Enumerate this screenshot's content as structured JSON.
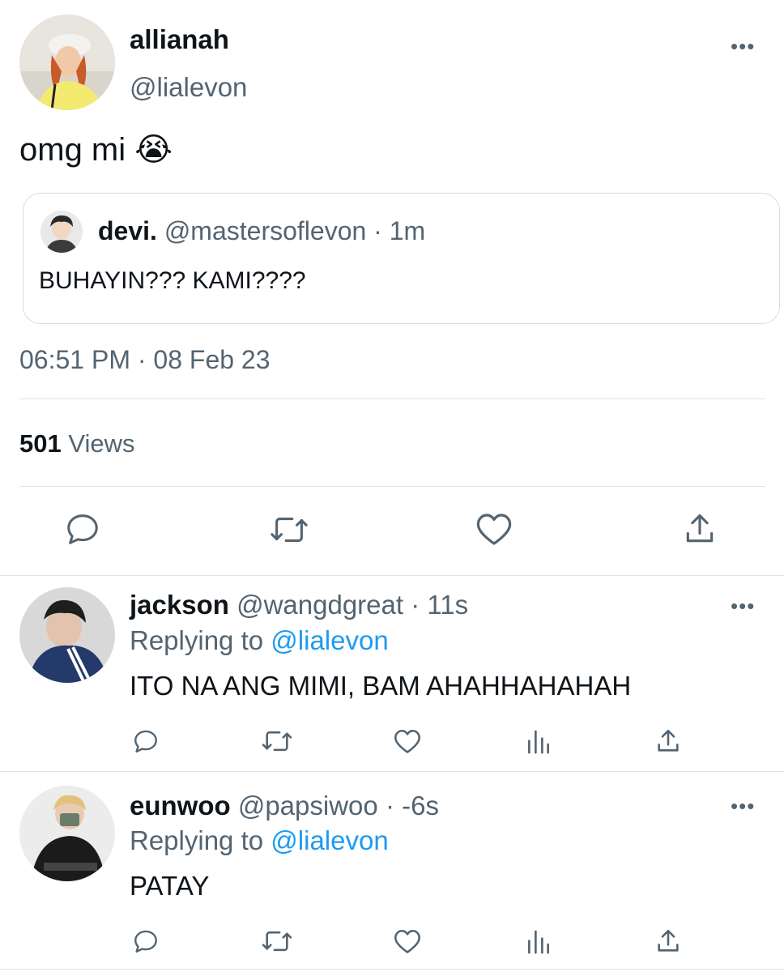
{
  "main_tweet": {
    "display_name": "allianah",
    "handle": "@lialevon",
    "text": "omg mi",
    "emoji": "😭",
    "more_label": "•••",
    "quoted": {
      "display_name": "devi.",
      "handle": "@mastersoflevon",
      "time": "· 1m",
      "text": "BUHAYIN??? KAMI????"
    },
    "timestamp": "06:51 PM · 08 Feb 23",
    "views_count": "501",
    "views_label": "Views",
    "actions": [
      "reply-icon",
      "retweet-icon",
      "like-icon",
      "share-icon"
    ]
  },
  "replies": [
    {
      "display_name": "jackson",
      "handle": "@wangdgreat",
      "time": "· 11s",
      "replying_prefix": "Replying to",
      "replying_to": "@lialevon",
      "text": "ITO NA ANG MIMI, BAM AHAHHAHAHAH",
      "more_label": "•••"
    },
    {
      "display_name": "eunwoo",
      "handle": "@papsiwoo",
      "time": "· -6s",
      "replying_prefix": "Replying to",
      "replying_to": "@lialevon",
      "text": "PATAY",
      "more_label": "•••"
    }
  ],
  "colors": {
    "text": "#0f1419",
    "muted": "#536471",
    "link": "#1d9bf0",
    "divider": "#dfe4e8"
  }
}
